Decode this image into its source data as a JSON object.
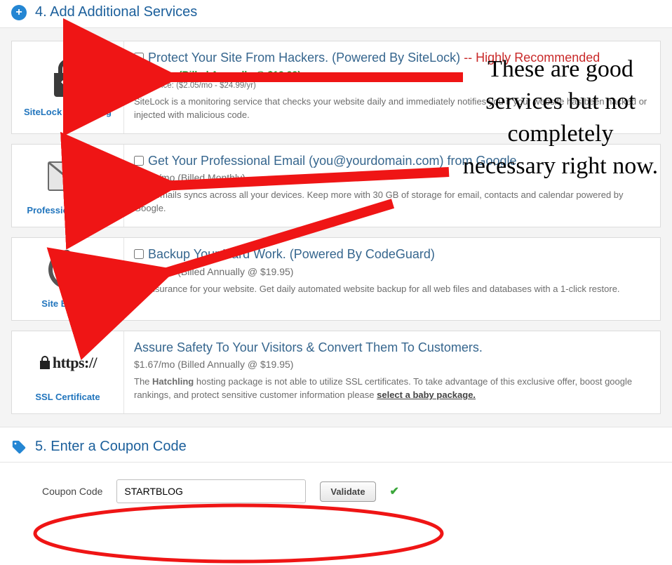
{
  "section4": {
    "title": "4. Add Additional Services",
    "addons": [
      {
        "name": "SiteLock Monitoring",
        "has_checkbox": true,
        "title": "Protect Your Site From Hackers. (Powered By SiteLock)",
        "recommend": " -- Highly Recommended",
        "price": "$1.67/mo (Billed Annually @ $19.99)",
        "price_style": "green",
        "reg_price": "Reg. Price: ($2.05/mo - $24.99/yr)",
        "desc": "SiteLock is a monitoring service that checks your website daily and immediately notifies you if your website has been hacked or injected with malicious code."
      },
      {
        "name": "Professional Email",
        "has_checkbox": true,
        "title": "Get Your Professional Email (you@yourdomain.com) from Google",
        "recommend": "",
        "price": "$5.00/mo (Billed Monthly)",
        "price_style": "plain",
        "reg_price": "",
        "desc": "Your emails syncs across all your devices. Keep more with 30 GB of storage for email, contacts and calendar powered by Google."
      },
      {
        "name": "Site Backup",
        "has_checkbox": true,
        "title": "Backup Your Hard Work. (Powered By CodeGuard)",
        "recommend": "",
        "price": "$1.67/mo (Billed Annually @ $19.95)",
        "price_style": "plain",
        "reg_price": "",
        "desc": "It's insurance for your website. Get daily automated website backup for all web files and databases with a 1-click restore."
      },
      {
        "name": "SSL Certificate",
        "has_checkbox": false,
        "title": "Assure Safety To Your Visitors & Convert Them To Customers.",
        "recommend": "",
        "price": "$1.67/mo (Billed Annually @ $19.95)",
        "price_style": "plain",
        "reg_price": "",
        "desc_prefix": "The ",
        "desc_bold": "Hatchling",
        "desc_mid": " hosting package is not able to utilize SSL certificates. To take advantage of this exclusive offer, boost google rankings, and protect sensitive customer information please ",
        "desc_link": "select a baby package."
      }
    ]
  },
  "section5": {
    "title": "5. Enter a Coupon Code",
    "label": "Coupon Code",
    "value": "STARTBLOG",
    "button": "Validate"
  },
  "annotation": "These are good services but not completely necessary right now."
}
